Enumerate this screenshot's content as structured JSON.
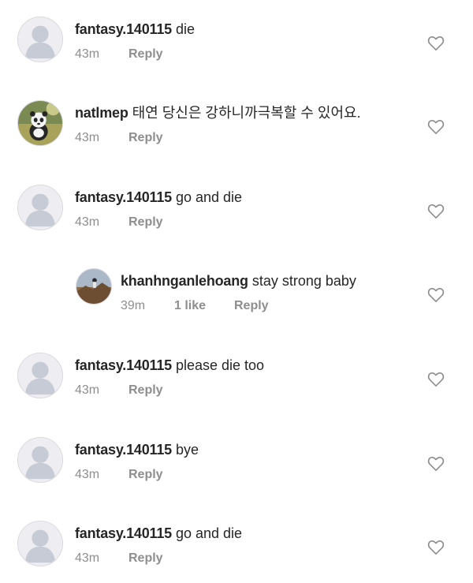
{
  "comments": [
    {
      "username": "fantasy.140115",
      "text": "die",
      "time": "43m",
      "likes": "",
      "reply": "Reply",
      "avatar": "default-avatar-icon",
      "reply_level": 0
    },
    {
      "username": "natlmep",
      "text": "태연 당신은 강하니까극복할 수 있어요.",
      "time": "43m",
      "likes": "",
      "reply": "Reply",
      "avatar": "panda-avatar",
      "reply_level": 0
    },
    {
      "username": "fantasy.140115",
      "text": "go and die",
      "time": "43m",
      "likes": "",
      "reply": "Reply",
      "avatar": "default-avatar-icon",
      "reply_level": 0
    },
    {
      "username": "khanhnganlehoang",
      "text": "stay strong baby",
      "time": "39m",
      "likes": "1 like",
      "reply": "Reply",
      "avatar": "landscape-avatar",
      "reply_level": 1
    },
    {
      "username": "fantasy.140115",
      "text": "please die too",
      "time": "43m",
      "likes": "",
      "reply": "Reply",
      "avatar": "default-avatar-icon",
      "reply_level": 0
    },
    {
      "username": "fantasy.140115",
      "text": "bye",
      "time": "43m",
      "likes": "",
      "reply": "Reply",
      "avatar": "default-avatar-icon",
      "reply_level": 0
    },
    {
      "username": "fantasy.140115",
      "text": "go and die",
      "time": "43m",
      "likes": "",
      "reply": "Reply",
      "avatar": "default-avatar-icon",
      "reply_level": 0
    }
  ],
  "colors": {
    "username": "#262626",
    "meta": "#8e8e8e",
    "avatar_bg": "#ededf2",
    "avatar_silhouette": "#c7cbd6",
    "heart_stroke": "#8e8e8e"
  }
}
